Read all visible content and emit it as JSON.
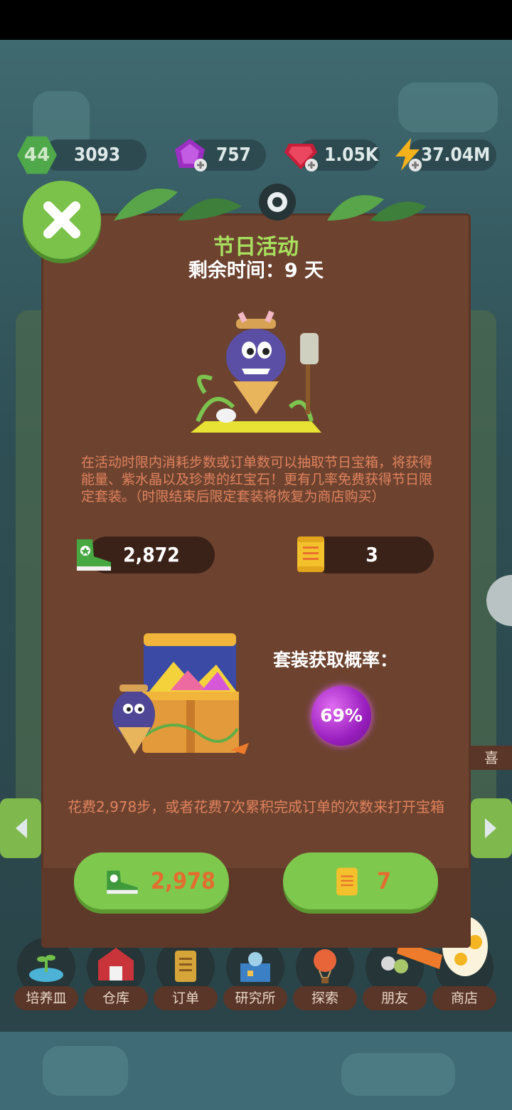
{
  "resources": {
    "level": "44",
    "coins": "3093",
    "purple_gems": "757",
    "red_gems": "1.05K",
    "energy": "37.04M"
  },
  "event": {
    "title": "节日活动",
    "time_remaining": "剩余时间：9 天",
    "description": "在活动时限内消耗步数或订单数可以抽取节日宝箱，将获得能量、紫水晶以及珍贵的红宝石！更有几率免费获得节日限定套装。（时限结束后限定套装将恢复为商店购买）",
    "steps_owned": "2,872",
    "orders_owned": "3",
    "set_chance_label": "套装获取概率：",
    "set_chance_value": "69%",
    "cost_text": "花费2,978步，或者花费7次累积完成订单的次数来打开宝箱",
    "steps_cost": "2,978",
    "orders_cost": "7"
  },
  "side_label_fragment": "喜",
  "nav": [
    {
      "label": "培养皿",
      "icon": "petri-dish-icon"
    },
    {
      "label": "仓库",
      "icon": "barn-icon"
    },
    {
      "label": "订单",
      "icon": "scroll-icon"
    },
    {
      "label": "研究所",
      "icon": "lab-icon"
    },
    {
      "label": "探索",
      "icon": "balloon-icon"
    },
    {
      "label": "朋友",
      "icon": "friends-icon"
    },
    {
      "label": "商店",
      "icon": "egg-icon"
    }
  ],
  "colors": {
    "modal_bg": "#6d4330",
    "accent_green": "#7fc84e",
    "title_green": "#a8e05e",
    "desc_orange": "#e0825c",
    "button_text_orange": "#e36d2e"
  }
}
